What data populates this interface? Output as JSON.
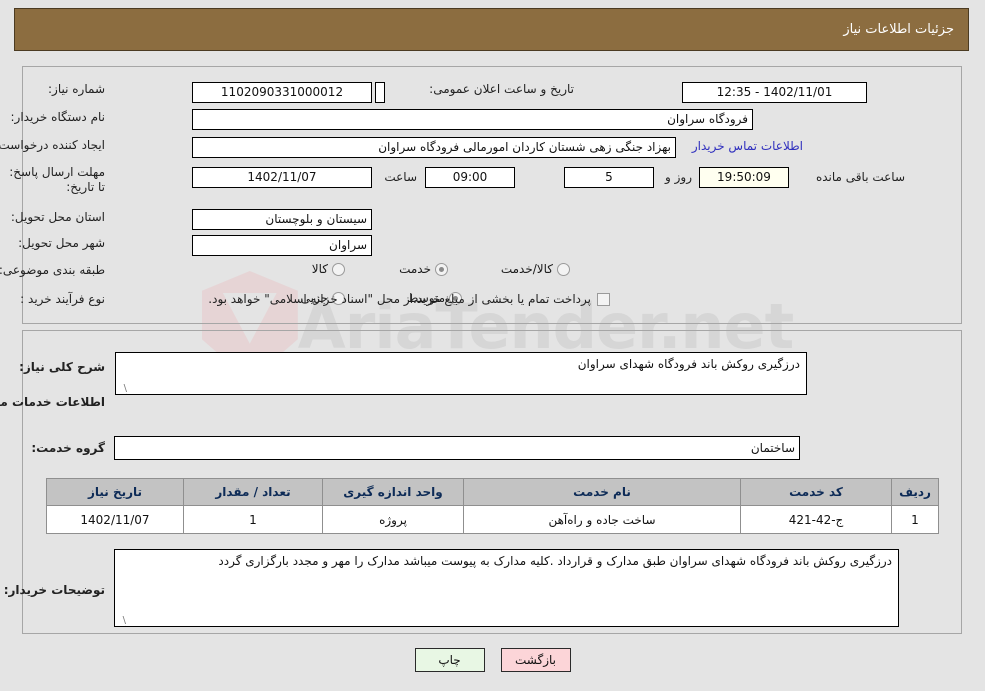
{
  "header": {
    "title": "جزئیات اطلاعات نیاز"
  },
  "watermark": {
    "text": "AriaTender.net"
  },
  "fields": {
    "need_number_label": "شماره نیاز:",
    "need_number_value": "1102090331000012",
    "announce_datetime_label": "تاریخ و ساعت اعلان عمومی:",
    "announce_datetime_value": "1402/11/01 - 12:35",
    "buyer_org_label": "نام دستگاه خریدار:",
    "buyer_org_value": "فرودگاه سراوان",
    "creator_label": "ایجاد کننده درخواست:",
    "creator_value": "بهزاد جنگی زهی شستان کاردان امورمالی فرودگاه سراوان",
    "contact_link": "اطلاعات تماس خریدار",
    "deadline_label": "مهلت ارسال پاسخ: تا تاریخ:",
    "deadline_date": "1402/11/07",
    "deadline_hour_label": "ساعت",
    "deadline_hour_value": "09:00",
    "remaining_days": "5",
    "remaining_days_label": "روز و",
    "remaining_time": "19:50:09",
    "remaining_time_label": "ساعت باقی مانده",
    "province_label": "استان محل تحویل:",
    "province_value": "سیستان و بلوچستان",
    "city_label": "شهر محل تحویل:",
    "city_value": "سراوان",
    "category_label": "طبقه بندی موضوعی:",
    "process_label": "نوع فرآیند خرید :",
    "treasury_note": "پرداخت تمام یا بخشی از مبلغ خرید،از محل \"اسناد خزانه اسلامی\" خواهد بود."
  },
  "category_options": [
    {
      "label": "کالا",
      "selected": false
    },
    {
      "label": "خدمت",
      "selected": true
    },
    {
      "label": "کالا/خدمت",
      "selected": false
    }
  ],
  "process_options": [
    {
      "label": "جزیی",
      "selected": false
    },
    {
      "label": "متوسط",
      "selected": true
    }
  ],
  "treasury_checkbox_checked": false,
  "description": {
    "need_summary_label": "شرح کلی نیاز:",
    "need_summary_value": "درزگیری روکش باند فرودگاه شهدای سراوان",
    "services_heading": "اطلاعات خدمات مورد نیاز",
    "service_group_label": "گروه خدمت:",
    "service_group_value": "ساختمان"
  },
  "table": {
    "columns": [
      "ردیف",
      "کد خدمت",
      "نام خدمت",
      "واحد اندازه گیری",
      "تعداد / مقدار",
      "تاریخ نیاز"
    ],
    "rows": [
      {
        "row_no": "1",
        "service_code": "ج-42-421",
        "service_name": "ساخت جاده و راه‌آهن",
        "unit": "پروژه",
        "quantity": "1",
        "need_date": "1402/11/07"
      }
    ]
  },
  "buyer_notes": {
    "label": "توضیحات خریدار:",
    "value": "درزگیری روکش باند فرودگاه شهدای سراوان طبق مدارک و قرارداد .کلیه مدارک به پیوست میباشد مدارک را مهر و مجدد بارگزاری گردد"
  },
  "buttons": {
    "print": "چاپ",
    "back": "بازگشت"
  },
  "colors": {
    "header_bg": "#8c6d40",
    "page_bg": "#e4e4e4",
    "link": "#2f2fbe",
    "table_header_bg": "#c3c3c3",
    "print_btn_bg": "#e8f7e4",
    "back_btn_bg": "#fcd5d8"
  }
}
